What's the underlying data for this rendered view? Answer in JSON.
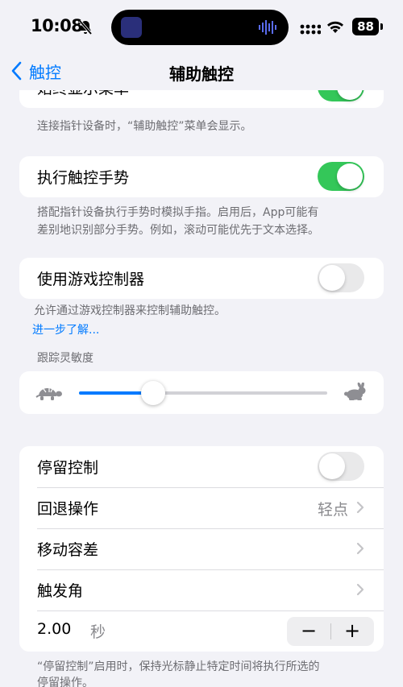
{
  "status": {
    "time": "10:08",
    "battery": "88"
  },
  "nav": {
    "back_label": "触控",
    "title": "辅助触控"
  },
  "section_show_menu": {
    "label": "始终显示菜单",
    "toggle_on": true,
    "note": "连接指针设备时，“辅助触控”菜单会显示。"
  },
  "section_gestures": {
    "label": "执行触控手势",
    "toggle_on": true,
    "note_line1": "搭配指针设备执行手势时模拟手指。启用后，App可能有",
    "note_line2": "差别地识别部分手势。例如，滚动可能优先于文本选择。"
  },
  "section_game_controller": {
    "label": "使用游戏控制器",
    "toggle_on": false,
    "note": "允许通过游戏控制器来控制辅助触控。",
    "link": "进一步了解..."
  },
  "tracking": {
    "header": "跟踪灵敏度",
    "value": 0.3
  },
  "dwell": {
    "dwell_label": "停留控制",
    "dwell_on": false,
    "revert_label": "回退操作",
    "revert_value": "轻点",
    "tolerance_label": "移动容差",
    "hot_corner_label": "触发角",
    "seconds_value": "2.00",
    "seconds_unit": "秒",
    "minus": "−",
    "plus": "+",
    "note_line1": "“停留控制”启用时，保持光标静止特定时间将执行所选的",
    "note_line2": "停留操作。"
  },
  "colors": {
    "accent": "#007aff",
    "toggle_on": "#34c759",
    "background": "#f2f2f7"
  }
}
